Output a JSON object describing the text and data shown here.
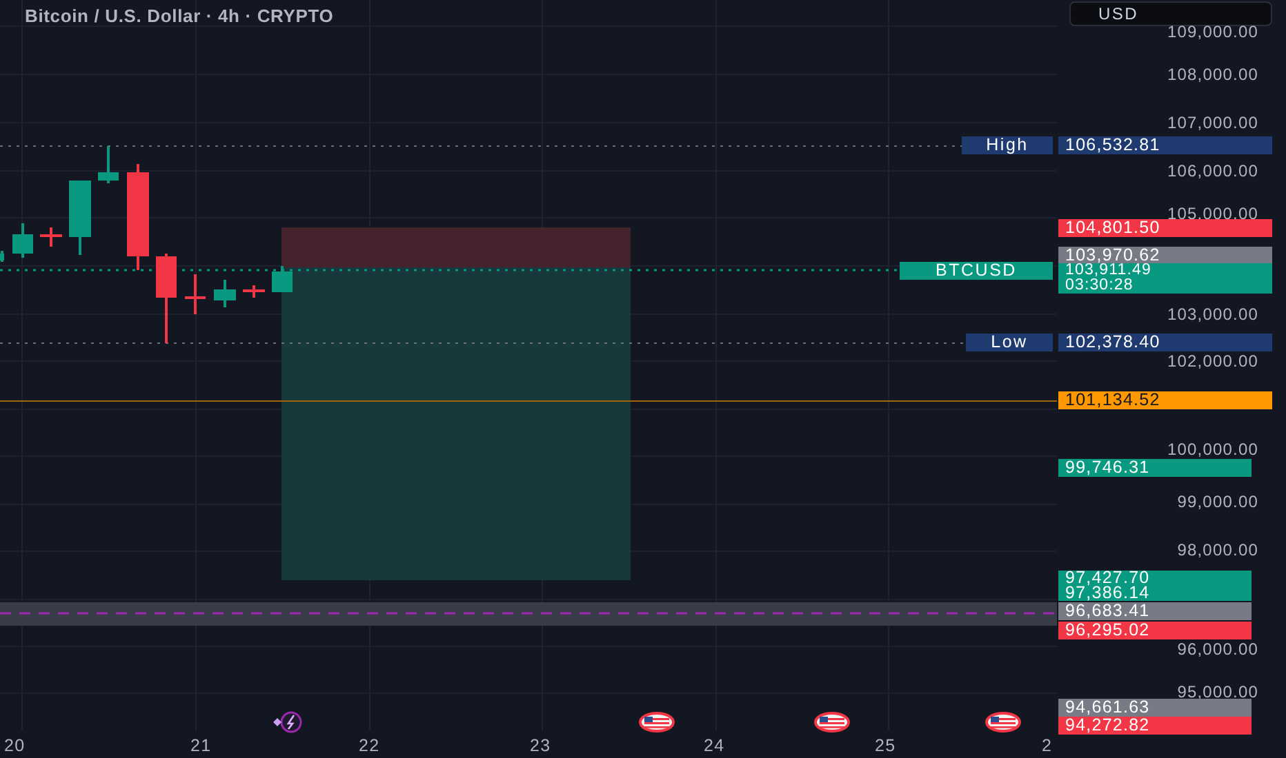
{
  "title": "Bitcoin / U.S. Dollar · 4h · CRYPTO",
  "currency": "USD",
  "price_ticks": [
    "109,000.00",
    "108,000.00",
    "107,000.00",
    "106,000.00",
    "105,000.00",
    "103,000.00",
    "102,000.00",
    "100,000.00",
    "99,000.00",
    "98,000.00",
    "96,000.00",
    "95,000.00"
  ],
  "time_ticks": [
    "20",
    "21",
    "22",
    "23",
    "24",
    "25",
    "2"
  ],
  "price_labels": [
    {
      "value": "106,532.81",
      "tag": "High",
      "color": "#1e3a6e"
    },
    {
      "value": "104,801.50",
      "color": "#f23645"
    },
    {
      "value": "103,970.62",
      "color": "#787b86"
    },
    {
      "value": "103,911.49",
      "countdown": "03:30:28",
      "tag": "BTCUSD",
      "color": "#089981"
    },
    {
      "value": "102,378.40",
      "tag": "Low",
      "color": "#1e3a6e"
    },
    {
      "value": "101,134.52",
      "color": "#ff9800"
    },
    {
      "value": "99,746.31",
      "color": "#089981"
    },
    {
      "value": "97,427.70",
      "color": "#089981"
    },
    {
      "value": "97,386.14",
      "color": "#089981"
    },
    {
      "value": "96,683.41",
      "color": "#787b86"
    },
    {
      "value": "96,295.02",
      "color": "#f23645"
    },
    {
      "value": "94,661.63",
      "color": "#787b86"
    },
    {
      "value": "94,272.82",
      "color": "#f23645"
    }
  ],
  "events": [
    {
      "kind": "lightning"
    },
    {
      "kind": "flag"
    },
    {
      "kind": "flag"
    },
    {
      "kind": "flag"
    }
  ]
}
